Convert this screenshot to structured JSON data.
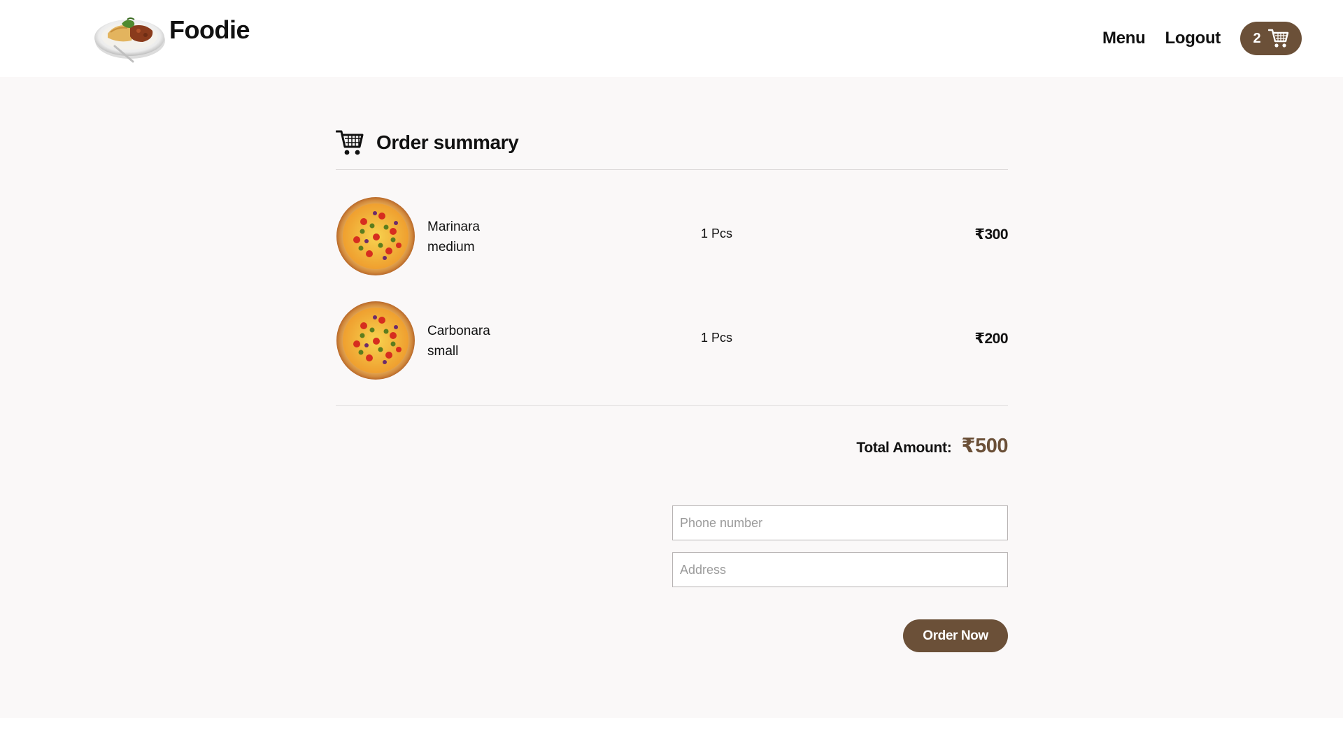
{
  "header": {
    "brand": "Foodie",
    "nav": {
      "menu_label": "Menu",
      "logout_label": "Logout"
    },
    "cart_count": "2"
  },
  "order": {
    "title": "Order summary",
    "items": [
      {
        "name": "Marinara",
        "size": "medium",
        "qty": "1 Pcs",
        "price": "₹300"
      },
      {
        "name": "Carbonara",
        "size": "small",
        "qty": "1 Pcs",
        "price": "₹200"
      }
    ],
    "total_label": "Total Amount:",
    "total_value": "₹500",
    "phone_placeholder": "Phone number",
    "address_placeholder": "Address",
    "order_button": "Order Now"
  },
  "colors": {
    "accent": "#6b5038",
    "page_bg": "#faf8f8",
    "header_bg": "#ffffff"
  },
  "icons": {
    "brand_logo": "plate-food-icon",
    "cart": "shopping-cart-icon",
    "product_thumb": "pizza-icon"
  }
}
